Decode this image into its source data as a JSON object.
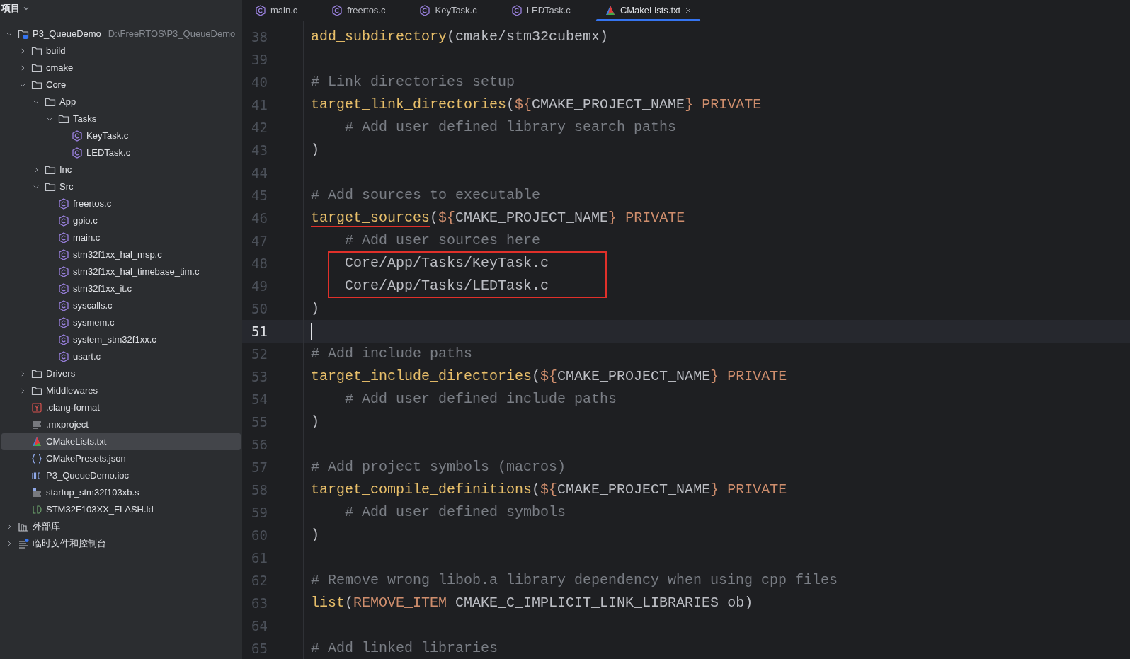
{
  "project_panel": {
    "title": "项目",
    "tree": [
      {
        "label": "P3_QueueDemo",
        "hint": "D:\\FreeRTOS\\P3_QueueDemo",
        "kind": "module",
        "expanded": true,
        "selected": false,
        "children": [
          {
            "label": "build",
            "kind": "folder",
            "expanded": false,
            "selected": false
          },
          {
            "label": "cmake",
            "kind": "folder",
            "expanded": false,
            "selected": false
          },
          {
            "label": "Core",
            "kind": "folder",
            "expanded": true,
            "selected": false,
            "children": [
              {
                "label": "App",
                "kind": "folder",
                "expanded": true,
                "selected": false,
                "children": [
                  {
                    "label": "Tasks",
                    "kind": "folder",
                    "expanded": true,
                    "selected": false,
                    "children": [
                      {
                        "label": "KeyTask.c",
                        "kind": "c",
                        "selected": false
                      },
                      {
                        "label": "LEDTask.c",
                        "kind": "c",
                        "selected": false
                      }
                    ]
                  }
                ]
              },
              {
                "label": "Inc",
                "kind": "folder",
                "expanded": false,
                "selected": false
              },
              {
                "label": "Src",
                "kind": "folder",
                "expanded": true,
                "selected": false,
                "children": [
                  {
                    "label": "freertos.c",
                    "kind": "c",
                    "selected": false
                  },
                  {
                    "label": "gpio.c",
                    "kind": "c",
                    "selected": false
                  },
                  {
                    "label": "main.c",
                    "kind": "c",
                    "selected": false
                  },
                  {
                    "label": "stm32f1xx_hal_msp.c",
                    "kind": "c",
                    "selected": false
                  },
                  {
                    "label": "stm32f1xx_hal_timebase_tim.c",
                    "kind": "c",
                    "selected": false
                  },
                  {
                    "label": "stm32f1xx_it.c",
                    "kind": "c",
                    "selected": false
                  },
                  {
                    "label": "syscalls.c",
                    "kind": "c",
                    "selected": false
                  },
                  {
                    "label": "sysmem.c",
                    "kind": "c",
                    "selected": false
                  },
                  {
                    "label": "system_stm32f1xx.c",
                    "kind": "c",
                    "selected": false
                  },
                  {
                    "label": "usart.c",
                    "kind": "c",
                    "selected": false
                  }
                ]
              }
            ]
          },
          {
            "label": "Drivers",
            "kind": "folder",
            "expanded": false,
            "selected": false
          },
          {
            "label": "Middlewares",
            "kind": "folder",
            "expanded": false,
            "selected": false
          },
          {
            "label": ".clang-format",
            "kind": "yaml",
            "selected": false
          },
          {
            "label": ".mxproject",
            "kind": "text",
            "selected": false
          },
          {
            "label": "CMakeLists.txt",
            "kind": "cmake",
            "selected": true
          },
          {
            "label": "CMakePresets.json",
            "kind": "json",
            "selected": false
          },
          {
            "label": "P3_QueueDemo.ioc",
            "kind": "ioc",
            "selected": false
          },
          {
            "label": "startup_stm32f103xb.s",
            "kind": "asm",
            "selected": false
          },
          {
            "label": "STM32F103XX_FLASH.ld",
            "kind": "ld",
            "selected": false
          }
        ]
      },
      {
        "label": "外部库",
        "kind": "library",
        "expanded": false,
        "selected": false
      },
      {
        "label": "临时文件和控制台",
        "kind": "scratch",
        "expanded": false,
        "selected": false
      }
    ]
  },
  "tabs": [
    {
      "label": "main.c",
      "kind": "c",
      "selected": false
    },
    {
      "label": "freertos.c",
      "kind": "c",
      "selected": false
    },
    {
      "label": "KeyTask.c",
      "kind": "c",
      "selected": false
    },
    {
      "label": "LEDTask.c",
      "kind": "c",
      "selected": false
    },
    {
      "label": "CMakeLists.txt",
      "kind": "cmake",
      "selected": true,
      "closable": true
    }
  ],
  "editor": {
    "lines": [
      {
        "number": "38",
        "tokens": [
          {
            "kind": "fn",
            "text": "add_subdirectory"
          },
          {
            "kind": "text",
            "text": "(cmake/stm32cubemx)"
          }
        ]
      },
      {
        "number": "39"
      },
      {
        "number": "40",
        "tokens": [
          {
            "kind": "comment",
            "text": "# Link directories setup"
          }
        ]
      },
      {
        "number": "41",
        "tokens": [
          {
            "kind": "fn",
            "text": "target_link_directories"
          },
          {
            "kind": "text",
            "text": "("
          },
          {
            "kind": "var",
            "text": "${"
          },
          {
            "kind": "text",
            "text": "CMAKE_PROJECT_NAME"
          },
          {
            "kind": "var",
            "text": "}"
          },
          {
            "kind": "kw",
            "text": " PRIVATE"
          }
        ]
      },
      {
        "number": "42",
        "tokens": [
          {
            "kind": "comment",
            "text": "    # Add user defined library search paths"
          }
        ]
      },
      {
        "number": "43",
        "tokens": [
          {
            "kind": "text",
            "text": ")"
          }
        ]
      },
      {
        "number": "44"
      },
      {
        "number": "45",
        "tokens": [
          {
            "kind": "comment",
            "text": "# Add sources to executable"
          }
        ]
      },
      {
        "number": "46",
        "tokens": [
          {
            "kind": "fn",
            "text": "target_sources",
            "underlined": true
          },
          {
            "kind": "text",
            "text": "("
          },
          {
            "kind": "var",
            "text": "${"
          },
          {
            "kind": "text",
            "text": "CMAKE_PROJECT_NAME"
          },
          {
            "kind": "var",
            "text": "}"
          },
          {
            "kind": "kw",
            "text": " PRIVATE"
          }
        ]
      },
      {
        "number": "47",
        "tokens": [
          {
            "kind": "comment",
            "text": "    # Add user sources here"
          }
        ]
      },
      {
        "number": "48",
        "boxed": true,
        "tokens": [
          {
            "kind": "text",
            "text": "    Core/App/Tasks/KeyTask.c"
          }
        ]
      },
      {
        "number": "49",
        "boxed": true,
        "tokens": [
          {
            "kind": "text",
            "text": "    Core/App/Tasks/LEDTask.c"
          }
        ]
      },
      {
        "number": "50",
        "tokens": [
          {
            "kind": "text",
            "text": ")"
          }
        ]
      },
      {
        "number": "51",
        "current": true
      },
      {
        "number": "52",
        "tokens": [
          {
            "kind": "comment",
            "text": "# Add include paths"
          }
        ]
      },
      {
        "number": "53",
        "tokens": [
          {
            "kind": "fn",
            "text": "target_include_directories"
          },
          {
            "kind": "text",
            "text": "("
          },
          {
            "kind": "var",
            "text": "${"
          },
          {
            "kind": "text",
            "text": "CMAKE_PROJECT_NAME"
          },
          {
            "kind": "var",
            "text": "}"
          },
          {
            "kind": "kw",
            "text": " PRIVATE"
          }
        ]
      },
      {
        "number": "54",
        "tokens": [
          {
            "kind": "comment",
            "text": "    # Add user defined include paths"
          }
        ]
      },
      {
        "number": "55",
        "tokens": [
          {
            "kind": "text",
            "text": ")"
          }
        ]
      },
      {
        "number": "56"
      },
      {
        "number": "57",
        "tokens": [
          {
            "kind": "comment",
            "text": "# Add project symbols (macros)"
          }
        ]
      },
      {
        "number": "58",
        "tokens": [
          {
            "kind": "fn",
            "text": "target_compile_definitions"
          },
          {
            "kind": "text",
            "text": "("
          },
          {
            "kind": "var",
            "text": "${"
          },
          {
            "kind": "text",
            "text": "CMAKE_PROJECT_NAME"
          },
          {
            "kind": "var",
            "text": "}"
          },
          {
            "kind": "kw",
            "text": " PRIVATE"
          }
        ]
      },
      {
        "number": "59",
        "tokens": [
          {
            "kind": "comment",
            "text": "    # Add user defined symbols"
          }
        ]
      },
      {
        "number": "60",
        "tokens": [
          {
            "kind": "text",
            "text": ")"
          }
        ]
      },
      {
        "number": "61"
      },
      {
        "number": "62",
        "tokens": [
          {
            "kind": "comment",
            "text": "# Remove wrong libob.a library dependency when using cpp files"
          }
        ]
      },
      {
        "number": "63",
        "tokens": [
          {
            "kind": "fn",
            "text": "list"
          },
          {
            "kind": "text",
            "text": "("
          },
          {
            "kind": "kw",
            "text": "REMOVE_ITEM"
          },
          {
            "kind": "text",
            "text": " CMAKE_C_IMPLICIT_LINK_LIBRARIES ob)"
          }
        ]
      },
      {
        "number": "64"
      },
      {
        "number": "65",
        "tokens": [
          {
            "kind": "comment",
            "text": "# Add linked libraries"
          }
        ]
      }
    ]
  }
}
